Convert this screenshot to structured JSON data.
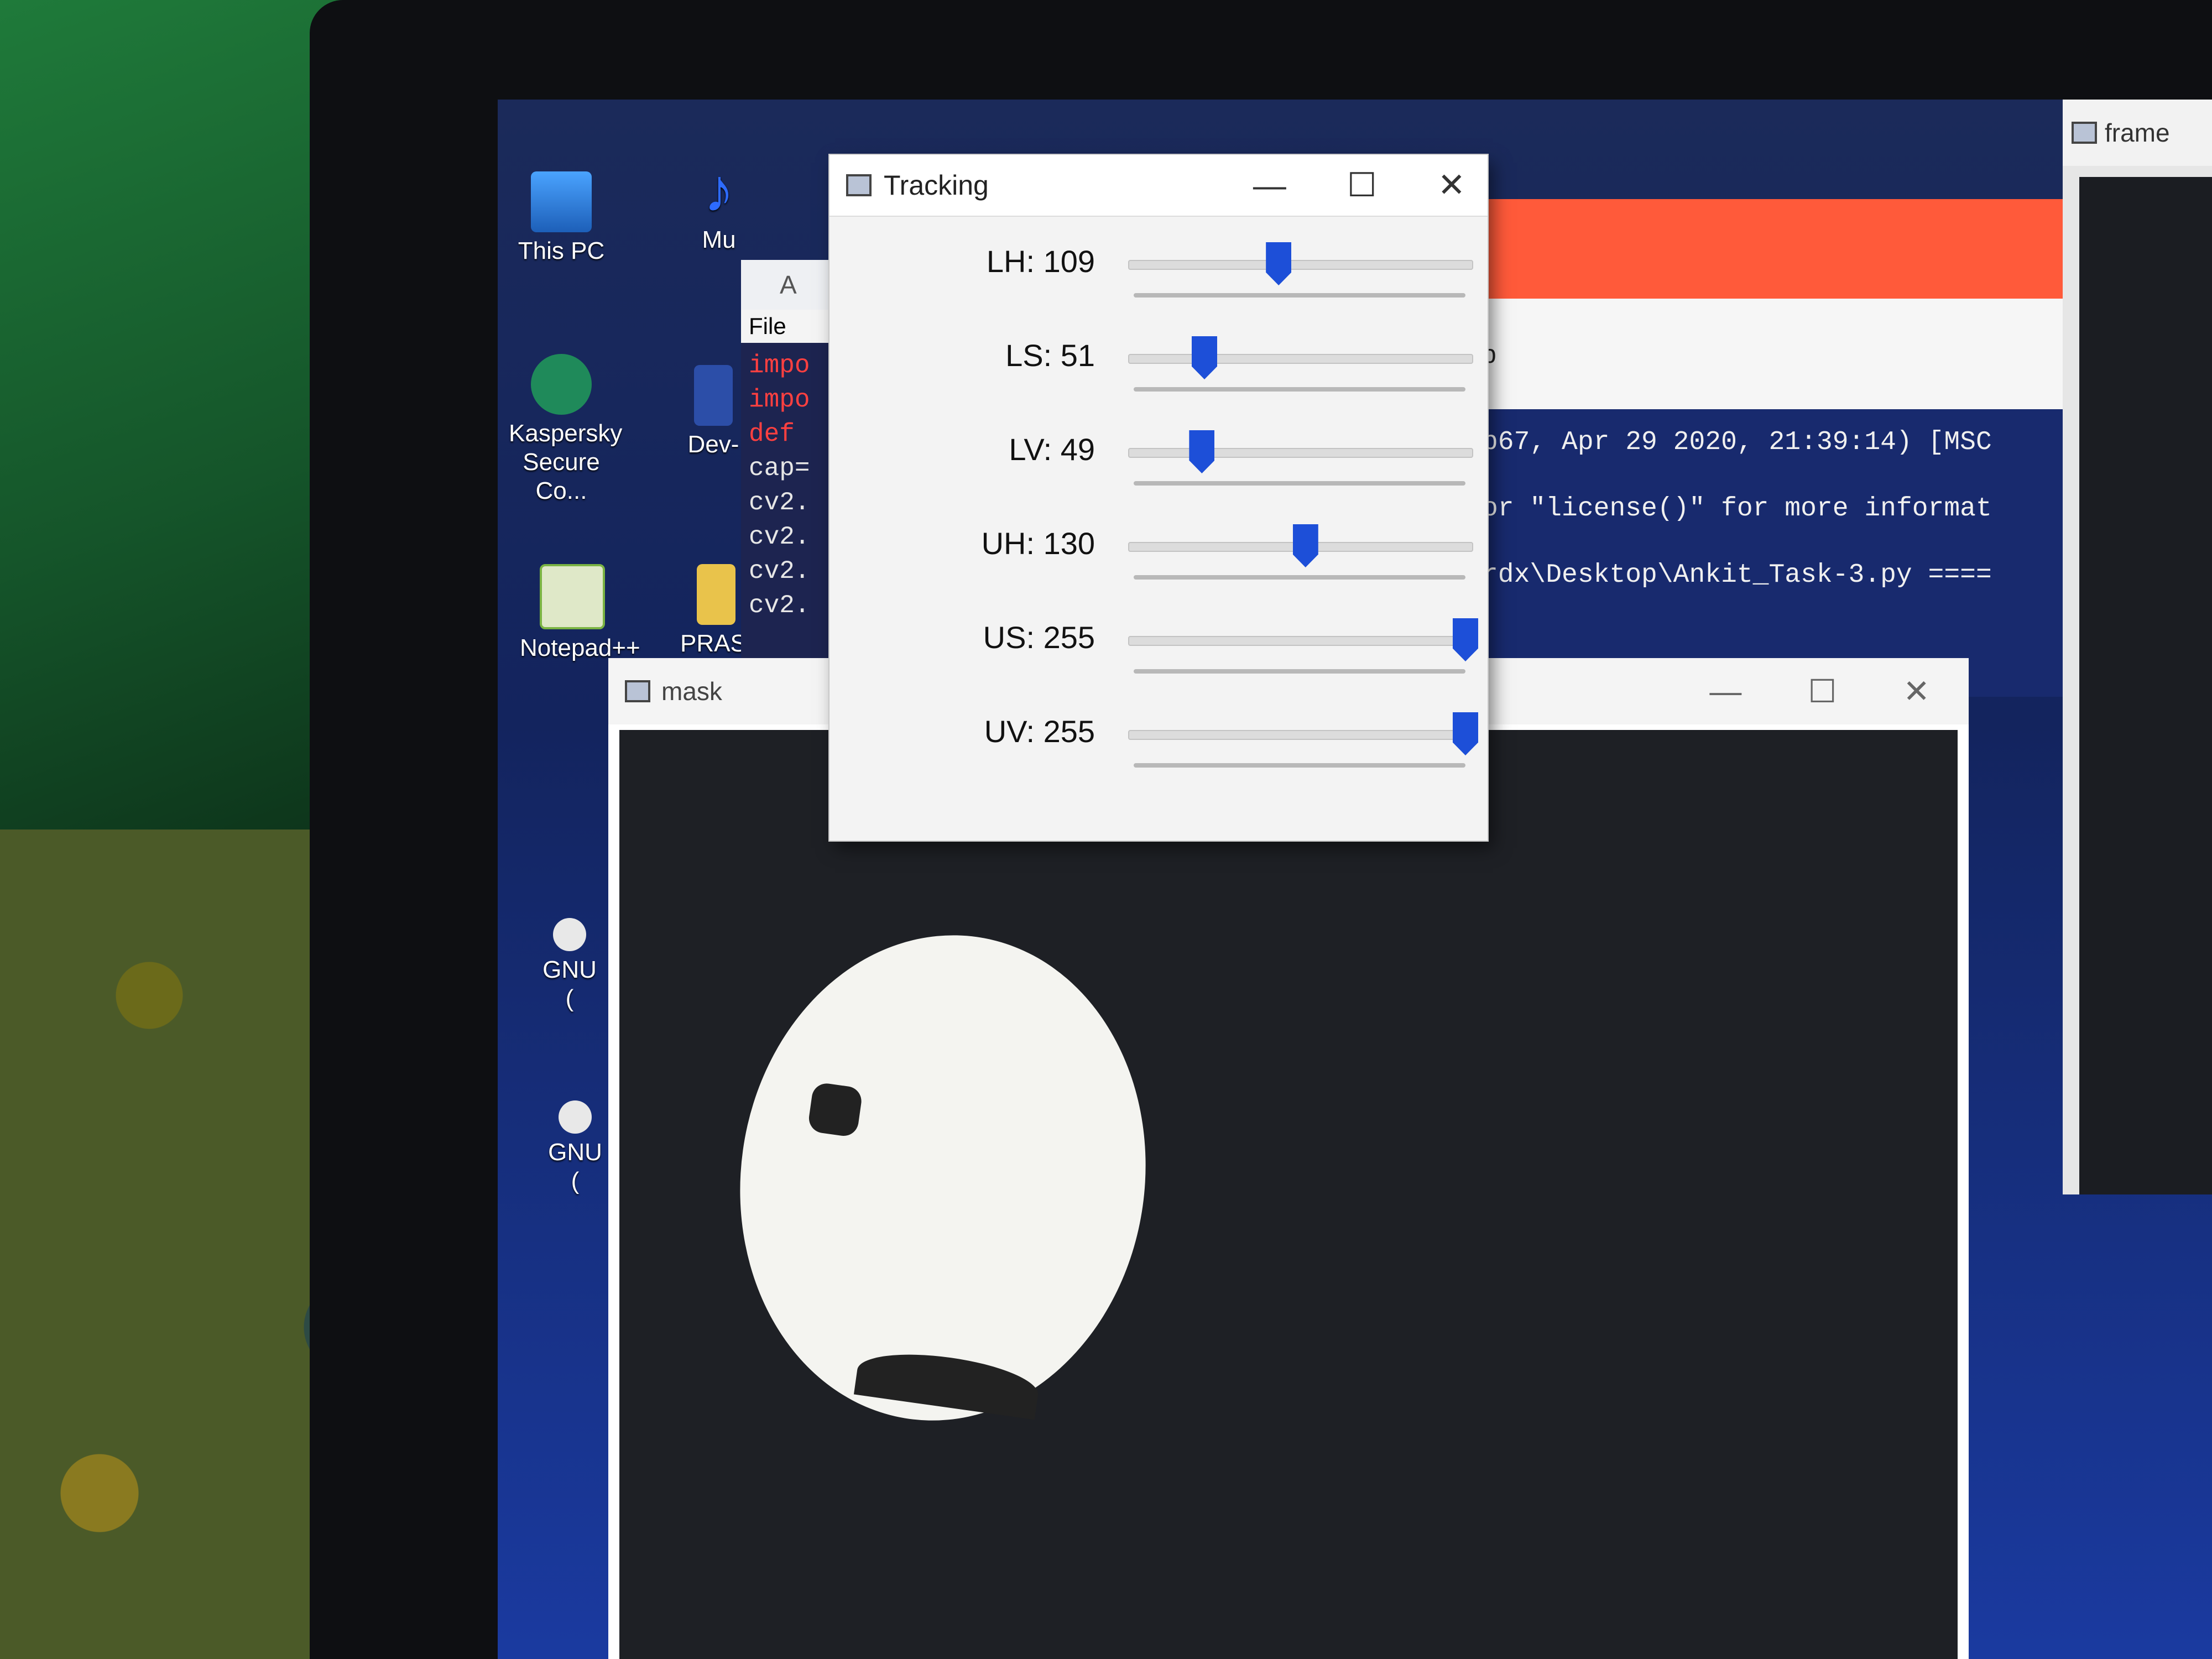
{
  "desktop": {
    "icons": [
      {
        "label": "This PC",
        "icon": "computer-icon"
      },
      {
        "label": "Mu",
        "icon": "music-icon"
      },
      {
        "label": "Kaspersky Secure Co...",
        "icon": "kaspersky-icon"
      },
      {
        "label": "Dev-",
        "icon": "dev-cpp-icon"
      },
      {
        "label": "Notepad++",
        "icon": "notepad-plus-plus-icon"
      },
      {
        "label": "PRASI",
        "icon": "folder-icon"
      },
      {
        "label": "GNU (",
        "icon": "gnu-icon"
      },
      {
        "label": "GNU (",
        "icon": "gnu-icon"
      }
    ]
  },
  "editor": {
    "title_initial": "A",
    "menu_file": "File",
    "code_lines": [
      "impo",
      "impo",
      "def",
      "",
      "cap=",
      "cv2.",
      "cv2.",
      "cv2.",
      "cv2."
    ]
  },
  "shell": {
    "header_fragment": "p",
    "lines": [
      "b67, Apr 29 2020, 21:39:14) [MSC",
      "or \"license()\" for more informat",
      "rdx\\Desktop\\Ankit_Task-3.py ===="
    ]
  },
  "frame_window": {
    "title": "frame"
  },
  "mask_window": {
    "title": "mask",
    "minimize": "—",
    "maximize": "☐",
    "close": "✕"
  },
  "tracking_window": {
    "title": "Tracking",
    "minimize": "—",
    "maximize": "☐",
    "close": "✕",
    "trackbars": [
      {
        "label": "LH: 109",
        "name": "LH",
        "value": 109,
        "max": 255
      },
      {
        "label": "LS: 51",
        "name": "LS",
        "value": 51,
        "max": 255
      },
      {
        "label": "LV: 49",
        "name": "LV",
        "value": 49,
        "max": 255
      },
      {
        "label": "UH: 130",
        "name": "UH",
        "value": 130,
        "max": 255
      },
      {
        "label": "US: 255",
        "name": "US",
        "value": 255,
        "max": 255
      },
      {
        "label": "UV: 255",
        "name": "UV",
        "value": 255,
        "max": 255
      }
    ]
  },
  "colors": {
    "thumb": "#1d4fd8",
    "mask_background": "#1e2025",
    "mask_foreground": "#f4f4f0"
  }
}
